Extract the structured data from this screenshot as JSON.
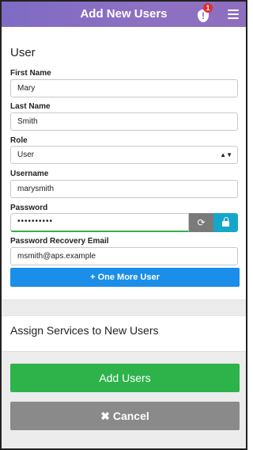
{
  "header": {
    "title": "Add New Users",
    "alert_count": "1",
    "alert_icon": "alert-shield-icon",
    "menu_icon": "hamburger-menu-icon",
    "gradient_colors": [
      "#7f6bc4",
      "#8e6fbe"
    ]
  },
  "user_section": {
    "title": "User",
    "first_name": {
      "label": "First Name",
      "value": "Mary"
    },
    "last_name": {
      "label": "Last Name",
      "value": "Smith"
    },
    "role": {
      "label": "Role",
      "value": "User"
    },
    "username": {
      "label": "Username",
      "value": "marysmith"
    },
    "password": {
      "label": "Password",
      "value": "••••••••••",
      "refresh_icon": "refresh-icon",
      "lock_icon": "lock-icon"
    },
    "recovery_email": {
      "label": "Password Recovery Email",
      "value": "msmith@aps.example"
    },
    "one_more_button": "+ One More User"
  },
  "assign_section": {
    "title": "Assign Services to New Users"
  },
  "actions": {
    "add_users": "Add Users",
    "cancel": "✖ Cancel"
  },
  "colors": {
    "primary_blue": "#1a8ee8",
    "success_green": "#2db34a",
    "neutral_gray": "#8a8a8a",
    "lock_teal": "#16a6c9",
    "badge_red": "#e12d2d"
  }
}
